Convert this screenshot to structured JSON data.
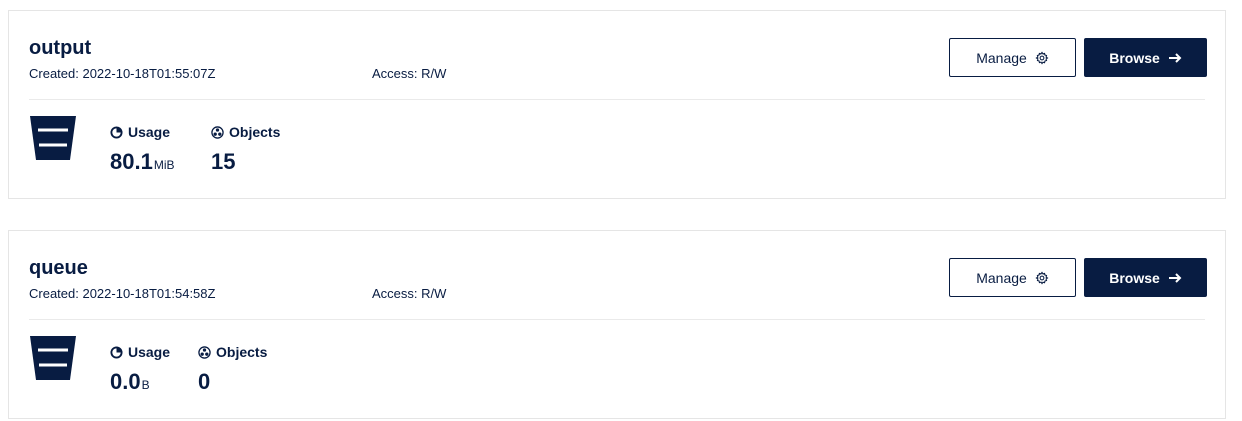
{
  "buckets": [
    {
      "name": "output",
      "created": "Created: 2022-10-18T01:55:07Z",
      "access": "Access: R/W",
      "manage_label": "Manage",
      "browse_label": "Browse",
      "usage_label": "Usage",
      "usage_value": "80.1",
      "usage_unit": "MiB",
      "objects_label": "Objects",
      "objects_value": "15"
    },
    {
      "name": "queue",
      "created": "Created: 2022-10-18T01:54:58Z",
      "access": "Access: R/W",
      "manage_label": "Manage",
      "browse_label": "Browse",
      "usage_label": "Usage",
      "usage_value": "0.0",
      "usage_unit": "B",
      "objects_label": "Objects",
      "objects_value": "0"
    }
  ],
  "icons": {
    "manage": "gear-icon",
    "browse": "arrow-right-icon",
    "bucket": "bucket-icon",
    "usage": "pie-chart-icon",
    "objects": "objects-icon"
  },
  "colors": {
    "primary": "#081c42",
    "border": "#e5e5e5",
    "background": "#ffffff"
  }
}
